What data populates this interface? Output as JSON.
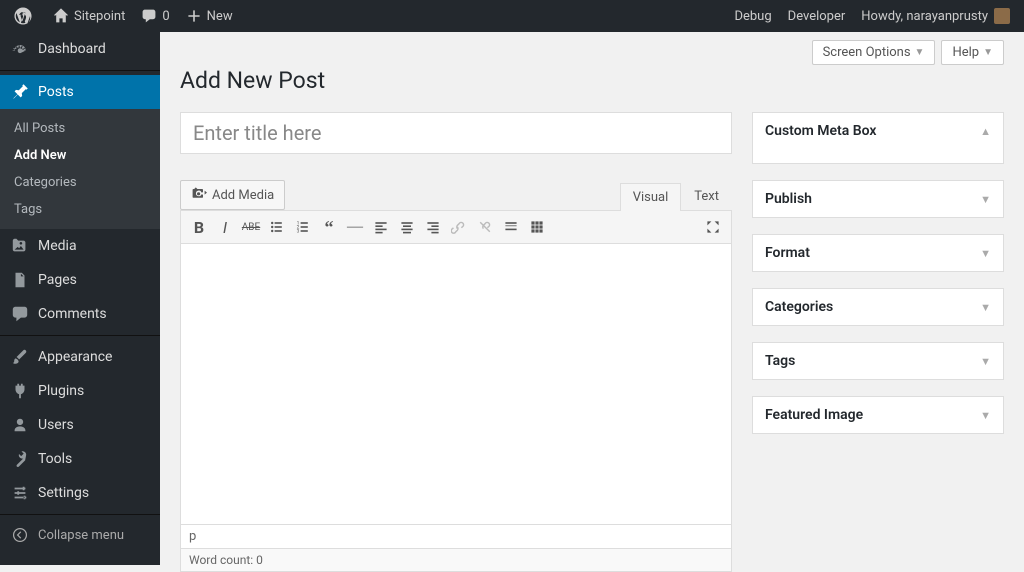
{
  "adminbar": {
    "site_name": "Sitepoint",
    "comments_count": "0",
    "new_label": "New",
    "debug": "Debug",
    "developer": "Developer",
    "howdy": "Howdy, narayanprusty"
  },
  "sidebar": {
    "dashboard": "Dashboard",
    "posts": "Posts",
    "posts_sub": {
      "all": "All Posts",
      "add": "Add New",
      "cats": "Categories",
      "tags": "Tags"
    },
    "media": "Media",
    "pages": "Pages",
    "comments": "Comments",
    "appearance": "Appearance",
    "plugins": "Plugins",
    "users": "Users",
    "tools": "Tools",
    "settings": "Settings",
    "collapse": "Collapse menu"
  },
  "topctrls": {
    "screen_options": "Screen Options",
    "help": "Help"
  },
  "page_title": "Add New Post",
  "editor": {
    "title_placeholder": "Enter title here",
    "add_media": "Add Media",
    "tab_visual": "Visual",
    "tab_text": "Text",
    "path": "p",
    "wordcount": "Word count: 0"
  },
  "metaboxes": {
    "custom": "Custom Meta Box",
    "publish": "Publish",
    "format": "Format",
    "categories": "Categories",
    "tags": "Tags",
    "featured": "Featured Image"
  }
}
